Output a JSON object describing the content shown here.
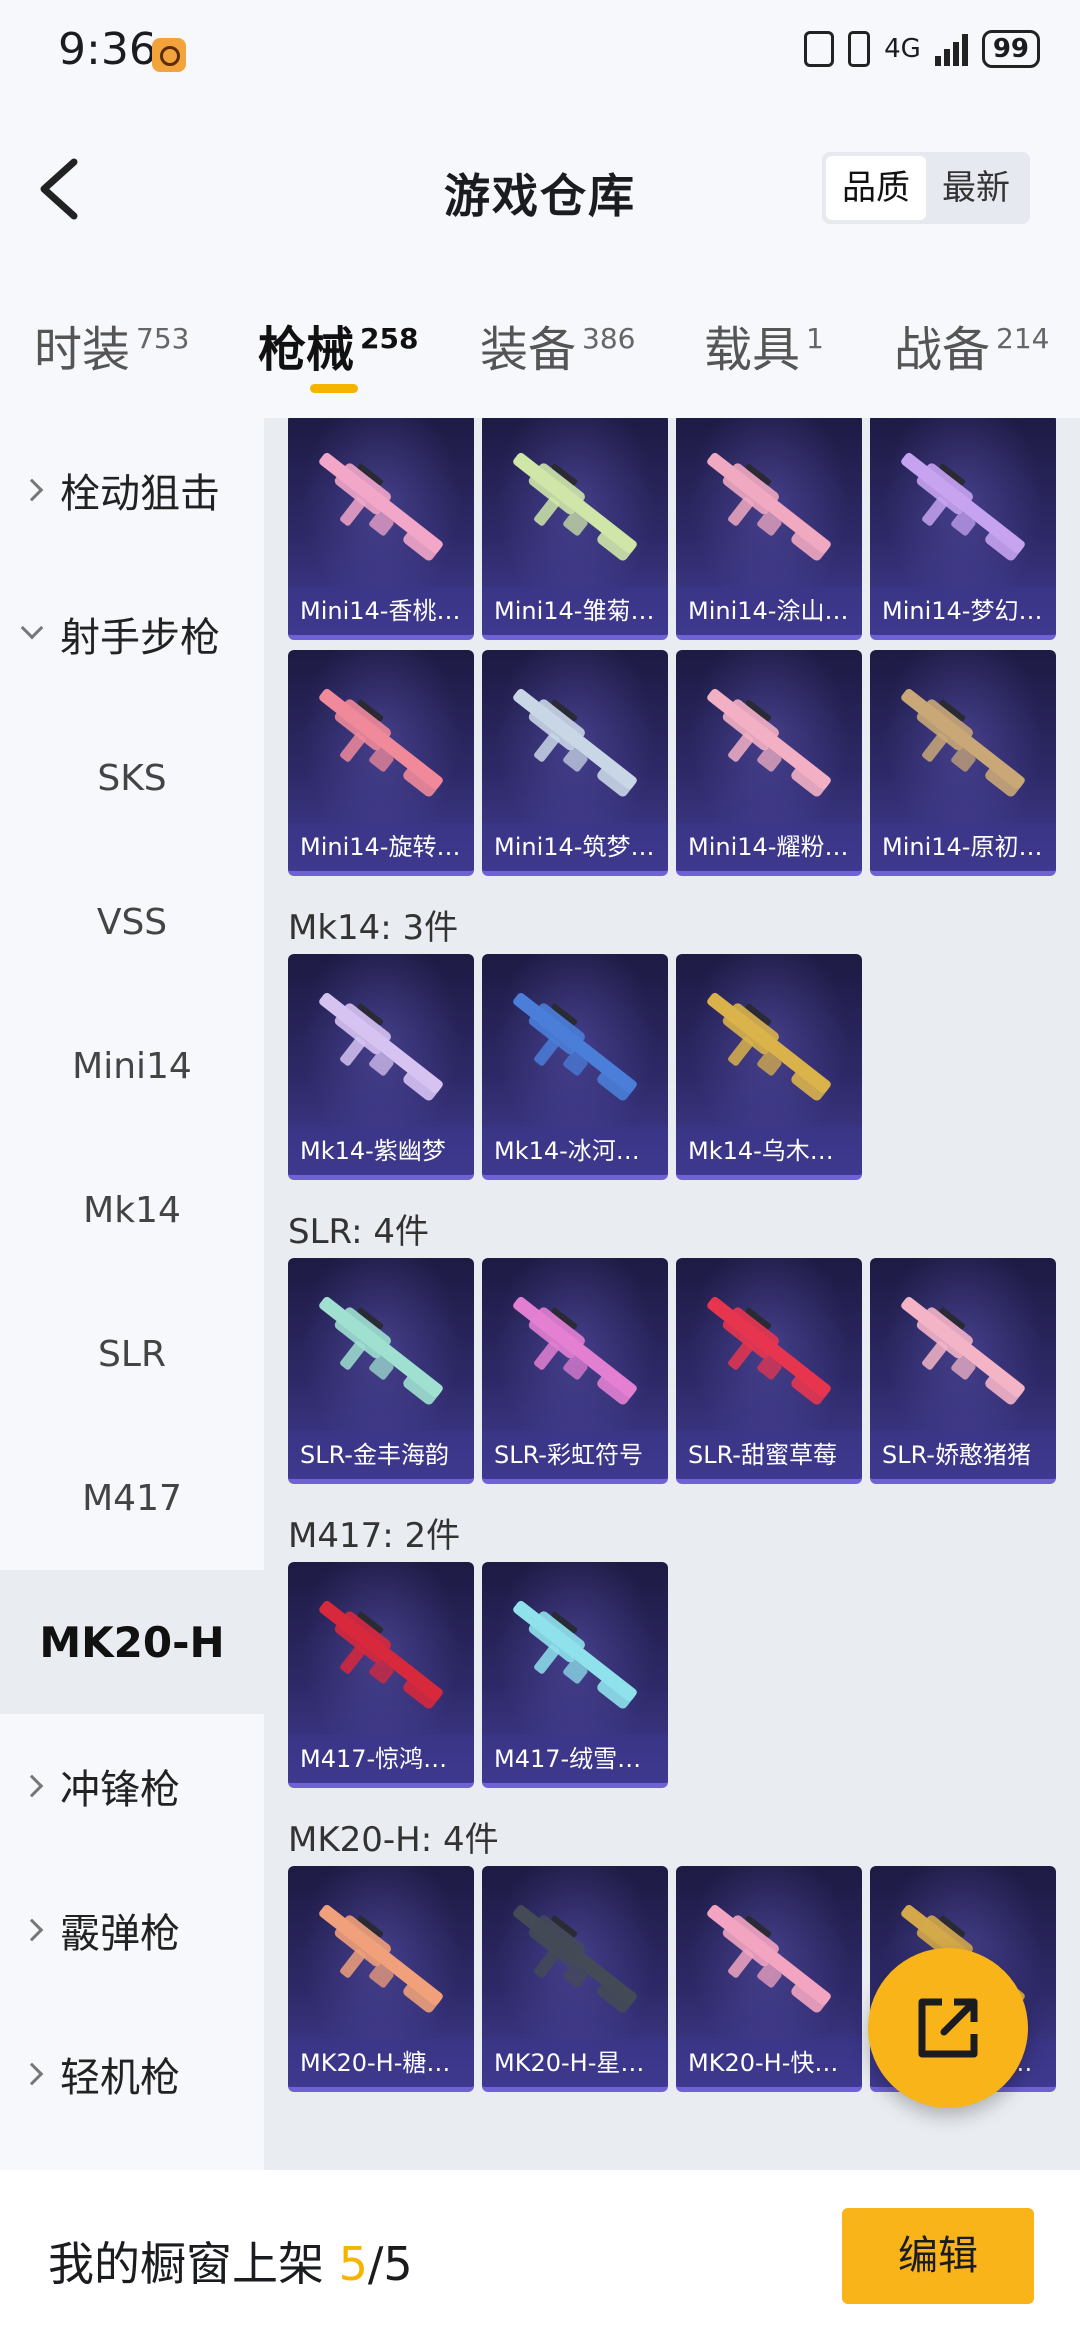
{
  "status_bar": {
    "time": "9:36",
    "network": "4G",
    "battery": "99"
  },
  "header": {
    "title": "游戏仓库",
    "sort_options": [
      "品质",
      "最新"
    ],
    "sort_selected": "品质"
  },
  "category_tabs": [
    {
      "label": "时装",
      "count": "753"
    },
    {
      "label": "枪械",
      "count": "258",
      "active": true
    },
    {
      "label": "装备",
      "count": "386"
    },
    {
      "label": "载具",
      "count": "1"
    },
    {
      "label": "战备",
      "count": "214"
    }
  ],
  "sidebar": [
    {
      "label": "栓动狙击",
      "type": "group",
      "expanded": false
    },
    {
      "label": "射手步枪",
      "type": "group",
      "expanded": true
    },
    {
      "label": "SKS",
      "type": "sub"
    },
    {
      "label": "VSS",
      "type": "sub"
    },
    {
      "label": "Mini14",
      "type": "sub"
    },
    {
      "label": "Mk14",
      "type": "sub"
    },
    {
      "label": "SLR",
      "type": "sub"
    },
    {
      "label": "M417",
      "type": "sub"
    },
    {
      "label": "MK20-H",
      "type": "sub",
      "active": true
    },
    {
      "label": "冲锋枪",
      "type": "group",
      "expanded": false
    },
    {
      "label": "霰弹枪",
      "type": "group",
      "expanded": false
    },
    {
      "label": "轻机枪",
      "type": "group",
      "expanded": false
    }
  ],
  "sections": [
    {
      "label": "",
      "items": [
        {
          "name": "Mini14-香桃…",
          "color": "#f2a6c8"
        },
        {
          "name": "Mini14-雏菊…",
          "color": "#cfe6a8"
        },
        {
          "name": "Mini14-涂山…",
          "color": "#f0a9c0"
        },
        {
          "name": "Mini14-梦幻…",
          "color": "#c6a3f0"
        },
        {
          "name": "Mini14-旋转…",
          "color": "#f08a9a"
        },
        {
          "name": "Mini14-筑梦…",
          "color": "#c9d6e6"
        },
        {
          "name": "Mini14-耀粉…",
          "color": "#f3b0c4"
        },
        {
          "name": "Mini14-原初…",
          "color": "#c9a777"
        }
      ]
    },
    {
      "label": "Mk14: 3件",
      "items": [
        {
          "name": "Mk14-紫幽梦",
          "color": "#d6c3f2"
        },
        {
          "name": "Mk14-冰河…",
          "color": "#4a7ed8"
        },
        {
          "name": "Mk14-乌木…",
          "color": "#d9b24a"
        }
      ]
    },
    {
      "label": "SLR: 4件",
      "items": [
        {
          "name": "SLR-金丰海韵",
          "color": "#9fe0d0"
        },
        {
          "name": "SLR-彩虹符号",
          "color": "#e37fd1"
        },
        {
          "name": "SLR-甜蜜草莓",
          "color": "#e8354f"
        },
        {
          "name": "SLR-娇憨猪猪",
          "color": "#f4b4c6"
        }
      ]
    },
    {
      "label": "M417: 2件",
      "items": [
        {
          "name": "M417-惊鸿…",
          "color": "#d8283c"
        },
        {
          "name": "M417-绒雪…",
          "color": "#8fe2ec"
        }
      ]
    },
    {
      "label": "MK20-H: 4件",
      "items": [
        {
          "name": "MK20-H-糖…",
          "color": "#f0a07a"
        },
        {
          "name": "MK20-H-星…",
          "color": "#444a56"
        },
        {
          "name": "MK20-H-快…",
          "color": "#f2a4c0"
        },
        {
          "name": "MK20-H-乌…",
          "color": "#d4a84a"
        }
      ]
    }
  ],
  "bottom_bar": {
    "shelf_label": "我的橱窗上架",
    "shelf_current": "5",
    "shelf_total": "/5",
    "edit_label": "编辑"
  },
  "colors": {
    "accent": "#f8b418",
    "card_bg": "#2d2967"
  }
}
